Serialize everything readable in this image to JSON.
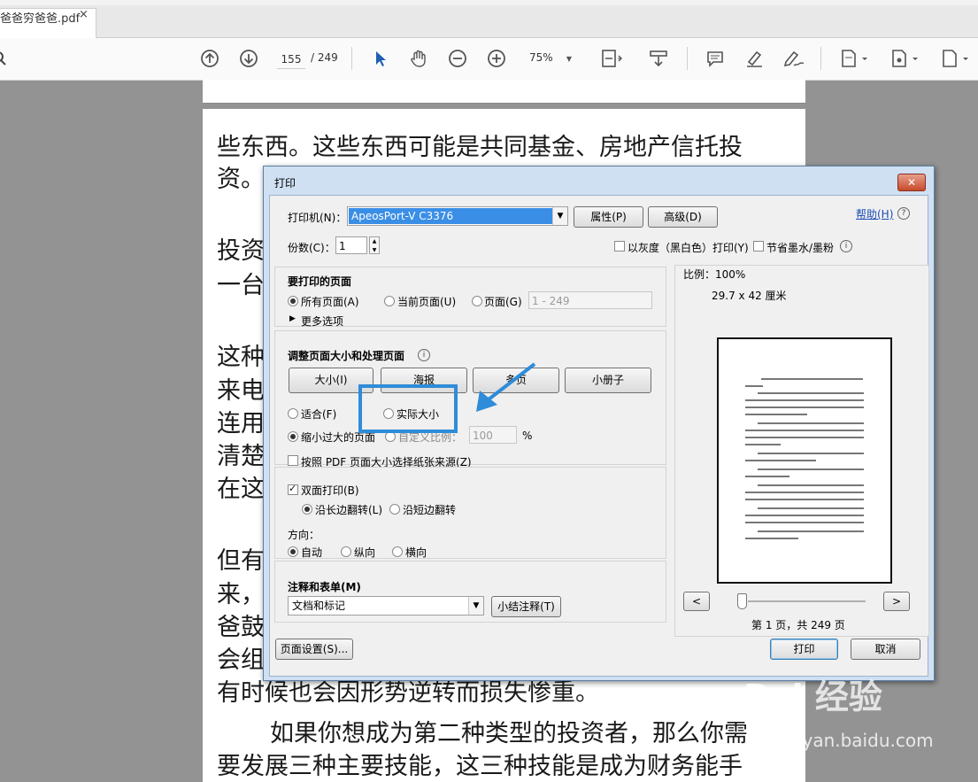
{
  "tab": {
    "title": "爸爸穷爸爸.pdf",
    "close": "×"
  },
  "toolbar": {
    "page_current": "155",
    "page_total": "/ 249",
    "zoom": "75%"
  },
  "pdf_text": [
    "些东西。这些东西可能是共同基金、房地产信托投",
    "资。",
    "投资",
    "一台",
    "这种",
    "来电",
    "连用",
    "清楚",
    "在这",
    "但有",
    "来，",
    "爸鼓",
    "会组",
    "有时候也会因形势逆转而损失惨重。",
    "如果你想成为第二种类型的投资者，那么你需",
    "要发展三种主要技能，这三种技能是成为财务能手"
  ],
  "dialog": {
    "title": "打印",
    "close": "✕",
    "printer_label": "打印机(N)：",
    "printer_value": "ApeosPort-V C3376",
    "properties_btn": "属性(P)",
    "advanced_btn": "高级(D)",
    "help_link": "帮助(H)",
    "copies_label": "份数(C)：",
    "copies_value": "1",
    "grayscale_label": "以灰度（黑白色）打印(Y)",
    "save_ink_label": "节省墨水/墨粉",
    "pages_group_title": "要打印的页面",
    "radio_all": "所有页面(A)",
    "radio_current": "当前页面(U)",
    "radio_pages": "页面(G)",
    "pages_range": "1 - 249",
    "more_options": "更多选项",
    "sizing_group_title": "调整页面大小和处理页面",
    "btn_size": "大小(I)",
    "btn_poster": "海报",
    "btn_multiple": "多页",
    "btn_booklet": "小册子",
    "radio_fit": "适合(F)",
    "radio_actual": "实际大小",
    "radio_shrink": "缩小过大的页面",
    "radio_custom": "自定义比例：",
    "custom_scale": "100",
    "percent": "%",
    "choose_paper_source": "按照 PDF 页面大小选择纸张来源(Z)",
    "duplex_label": "双面打印(B)",
    "flip_long": "沿长边翻转(L)",
    "flip_short": "沿短边翻转",
    "orientation_label": "方向：",
    "orient_auto": "自动",
    "orient_portrait": "纵向",
    "orient_landscape": "横向",
    "comments_title": "注释和表单(M)",
    "comments_value": "文档和标记",
    "summarize_btn": "小结注释(T)",
    "page_setup_btn": "页面设置(S)...",
    "print_btn": "打印",
    "cancel_btn": "取消",
    "scale_label": "比例：100%",
    "paper_size": "29.7 x 42 厘米",
    "prev_btn": "<",
    "next_btn": ">",
    "page_indicator": "第 1 页，共 249 页"
  },
  "watermark": {
    "brand": "Bai 经验",
    "url": "jingyan.baidu.com"
  },
  "colors": {
    "accent": "#2f8cd8",
    "dialog_frame": "#cfe0f2",
    "printer_select": "#3a8ee6"
  }
}
